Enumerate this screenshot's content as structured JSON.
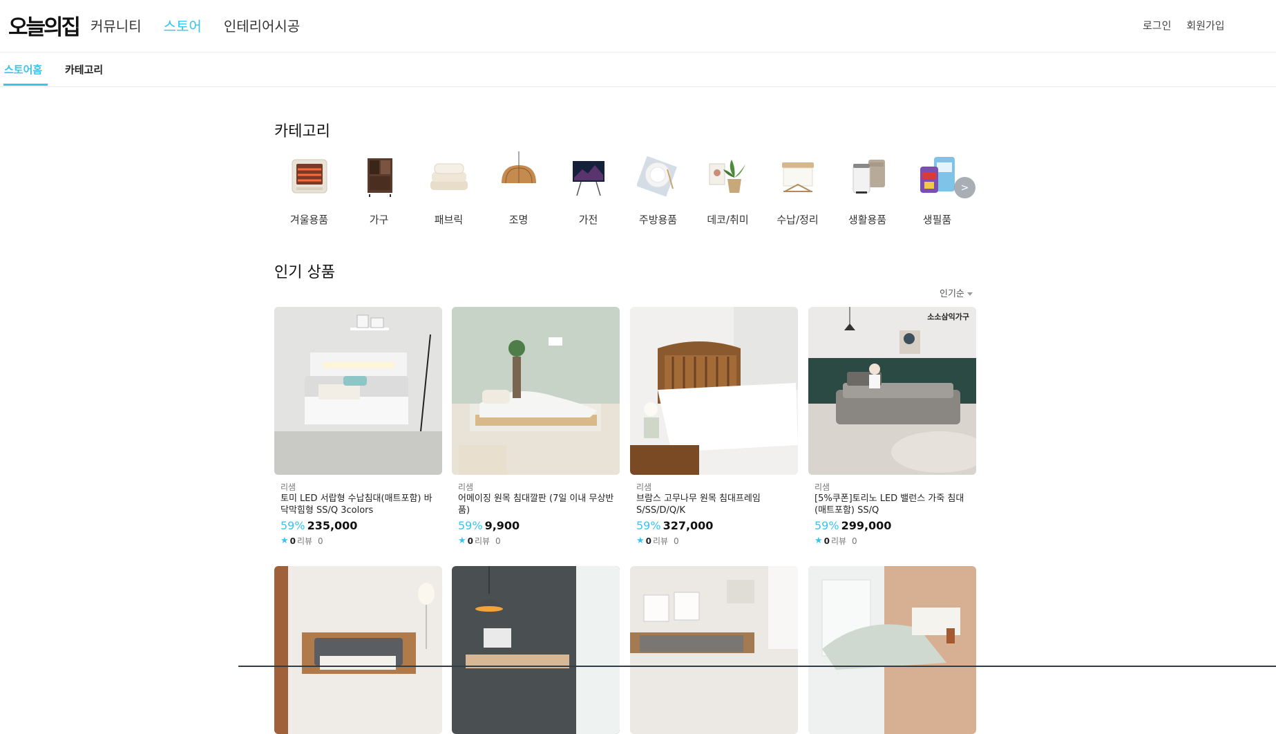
{
  "header": {
    "logo": "오늘의집",
    "nav": [
      "커뮤니티",
      "스토어",
      "인테리어시공"
    ],
    "active_nav": "스토어",
    "login": "로그인",
    "signup": "회원가입"
  },
  "subnav": {
    "tabs": [
      "스토어홈",
      "카테고리"
    ],
    "active": "스토어홈"
  },
  "categories": {
    "title": "카테고리",
    "items": [
      {
        "label": "겨울용품",
        "icon": "heater-icon"
      },
      {
        "label": "가구",
        "icon": "cabinet-icon"
      },
      {
        "label": "패브릭",
        "icon": "bedding-icon"
      },
      {
        "label": "조명",
        "icon": "pendant-lamp-icon"
      },
      {
        "label": "가전",
        "icon": "tv-icon"
      },
      {
        "label": "주방용품",
        "icon": "plates-icon"
      },
      {
        "label": "데코/취미",
        "icon": "plant-icon"
      },
      {
        "label": "수납/정리",
        "icon": "storage-box-icon"
      },
      {
        "label": "생활용품",
        "icon": "trash-can-icon"
      },
      {
        "label": "생필품",
        "icon": "detergent-icon"
      }
    ],
    "next_label": ">"
  },
  "popular": {
    "title": "인기 상품",
    "sort_label": "인기순",
    "products": [
      {
        "brand": "리샘",
        "name": "토미 LED 서랍형 수납침대(매트포함) 바닥막힘형 SS/Q 3colors",
        "discount": "59%",
        "price": "235,000",
        "rating": "0",
        "review_label": "리뷰",
        "reviews": "0"
      },
      {
        "brand": "리샘",
        "name": "어메이징 원목 침대깔판 (7일 이내 무상반품)",
        "discount": "59%",
        "price": "9,900",
        "rating": "0",
        "review_label": "리뷰",
        "reviews": "0"
      },
      {
        "brand": "리샘",
        "name": "브람스 고무나무 원목 침대프레임 S/SS/D/Q/K",
        "discount": "59%",
        "price": "327,000",
        "rating": "0",
        "review_label": "리뷰",
        "reviews": "0"
      },
      {
        "brand": "리샘",
        "name": "[5%쿠폰]토리노 LED 밸런스 가죽 침대(매트포함) SS/Q",
        "discount": "59%",
        "price": "299,000",
        "rating": "0",
        "review_label": "리뷰",
        "reviews": "0",
        "seal": "소소삼익가구"
      }
    ]
  },
  "colors": {
    "accent": "#35c5f0",
    "text": "#222222",
    "border": "#ececec"
  }
}
